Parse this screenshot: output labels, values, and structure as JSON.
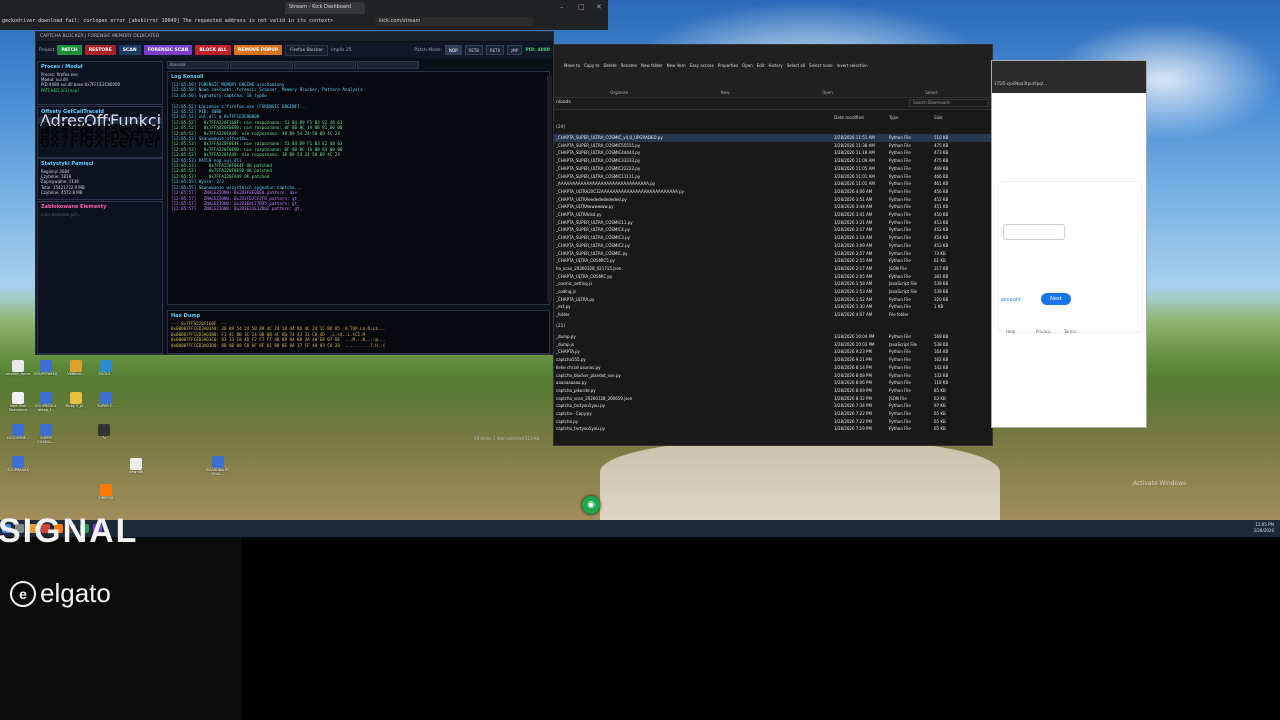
{
  "browser": {
    "tab_title": "Stream - Kick Dashboard",
    "error_text": "geckodriver download fail: curlopen error [abskirror 10049] The requested address is not valid in its context>",
    "url": "kick.com/stream"
  },
  "bottom": {
    "signal_text": "SIGNAL",
    "brand": "elgato"
  },
  "app": {
    "title": "CAPTCHA BLOCKER | FORENSIC MEMORY DEDICATED",
    "toolbar": {
      "project_label": "Project",
      "patch": "PATCH",
      "restore": "RESTORE",
      "scan": "SCAN",
      "forensic_scan": "FORENSIC SCAN",
      "block_all": "BLOCK ALL",
      "remove_popup": "REMOVE POPUP",
      "browser_select": "Firefox Blocker",
      "impl_label": "Implis 25",
      "patch_mode_label": "Patch Mode:",
      "modes": [
        "NOP",
        "RETB",
        "RET0",
        "JMP"
      ],
      "pid_label": "PID: 4080"
    },
    "process": {
      "heading": "Proces / Moduł",
      "lines": [
        "Proces: firefox.exe",
        "Moduł: xul.dll",
        "PID:4080 xul.dll base:0x7FFCE3C80000",
        "PATCHED 3/3 [nop]"
      ]
    },
    "offsets": {
      "heading": "Offsety GetCallTraceId",
      "col_addr": "Adres",
      "col_off": "Offset",
      "col_fn": "Funkcja",
      "rows": [
        {
          "addr": "0x7FFA220F160F",
          "off": "0xF164F",
          "fn": "serverCall->GetCa"
        },
        {
          "addr": "0x7FFA220F0E9D",
          "off": "0xF0E9D",
          "fn": "pServerCall->GetC"
        },
        {
          "addr": "0x7FFA220FA49",
          "off": "0xFA49",
          "fn": "serverCall->GetCa"
        }
      ]
    },
    "stats": {
      "heading": "Statystyki Pamięci",
      "lines": [
        "Regiony: 3084",
        "Czytelne: 1818",
        "Zapisywalne: 1136",
        "Total: 15421722.9 MB",
        "Czytelne: 4572.8 MB"
      ]
    },
    "blocked": {
      "heading": "Zablokowane Elementy",
      "placeholder": "Lista blokowanych..."
    },
    "log_tabs": [
      "Konsola",
      "",
      "",
      ""
    ],
    "log": {
      "heading": "Log Konsoli",
      "lines": [
        {
          "t": "[12:05:50] FORENSIC MEMORY ENGINE uruchomiony",
          "c": "#5fd1ff"
        },
        {
          "t": "[12:05:50] Nowe zakładki: forensic Scanner, Memory Blocker, Pattern Analysis",
          "c": "#5fd1ff"
        },
        {
          "t": "[12:05:50] Sygnatury captcha: 18 typów",
          "c": "#5fd1ff"
        },
        {
          "t": "",
          "c": "#5fd1ff"
        },
        {
          "t": "[12:05:52] Łączenie z firefox.exe [FORENSIC ENGINE]...",
          "c": "#5fd1ff"
        },
        {
          "t": "[12:05:52] PID: 4080",
          "c": "#5fd1ff"
        },
        {
          "t": "[12:05:52] xul.dll @ 0x7FFCE3C80000",
          "c": "#5fd1ff"
        },
        {
          "t": "[12:05:52]   0x7FFA220F160F: nie rozpoznano: 53 84 B9 F1 B3 E2 48 63",
          "c": "#6fe08a"
        },
        {
          "t": "[12:05:52]   0x7FFA220F0E9D: nie rozpoznano: 0F 88 8C 1A 0B 81 00 00",
          "c": "#6fe08a"
        },
        {
          "t": "[12:05:52]   0x7FFA220FA49: nie rozpoznano: 38 B9 54 24 50 B9 4C 24",
          "c": "#6fe08a"
        },
        {
          "t": "[12:05:53] Skanowanie offsetów...",
          "c": "#5fd1ff"
        },
        {
          "t": "[12:05:53]   0x7FFA220F0E4F: nie rozpoznano: 53 84 B9 F1 B3 E2 48 63",
          "c": "#6fe08a"
        },
        {
          "t": "[12:05:53]   0x7FFA220F0E9D: nie rozpoznano: 0F 88 8C 1A 0B 81 00 00",
          "c": "#6fe08a"
        },
        {
          "t": "[12:05:53]   0x7FFA220FA49: nie rozpoznano: 38 B9 54 24 50 B9 4C 24",
          "c": "#6fe08a"
        },
        {
          "t": "[12:05:53] PATCH nop xul.dll",
          "c": "#5fd1ff"
        },
        {
          "t": "[12:05:53]     0x7FFA220F0E4F OK patched",
          "c": "#6fe08a"
        },
        {
          "t": "[12:05:53]     0x7FFA220F0E9D OK patched",
          "c": "#6fe08a"
        },
        {
          "t": "[12:05:53]     0x7FFA220FA49 OK patched",
          "c": "#6fe08a"
        },
        {
          "t": "[12:05:55] Wynik: 3/3",
          "c": "#5fd1ff"
        },
        {
          "t": "[12:05:55] Skanowanie wszystkich sygnatur captcha...",
          "c": "#5fd1ff"
        },
        {
          "t": "[12:05:57]   ZNALEZIONO: 0x2D1F8E0DE0 pattern: div",
          "c": "#c77dff"
        },
        {
          "t": "[12:05:57]   ZNALEZIONO: 0x2D1FD2CF2F0 pattern: gt_",
          "c": "#c77dff"
        },
        {
          "t": "[12:05:57]   ZNALEZIONO: 0x2D1E0C77B95 pattern: gt_",
          "c": "#c77dff"
        },
        {
          "t": "[12:05:57]   ZNALEZIONO: 0x2D1E31E12D02 pattern: gt_",
          "c": "#c77dff"
        }
      ]
    },
    "hex": {
      "heading": "Hex Dump",
      "lines": [
        "--- 0x7FFA220F160F ---",
        "0x00007FFCED3A03A0: 38 89 54 24 50 89 4C 24 18 44 8D 4C 24 1C 8D 85  8.T$P.L$.D.L$...",
        "0x00007FFCED3A03B0: F1 4C 8B 3C 24 0B 0B 4C 8D 74 43 31 C0 4D  .L.<$..L.tC1.M",
        "0x00007FFCED3A03C0: 83 13 18 4D F2 F7 FF 4B 8B 04 B8 3A 40 E8 07 DE  ...M...K...:@...",
        "0x00007FFCED3A03D0: 8B 8B 08 C0 0F 8F 81 00 0E 8A 37 CF 48 83 C6 28  ..........7.H..("
      ]
    }
  },
  "explorer": {
    "ribbon": [
      "Move to",
      "Copy to",
      "Delete",
      "Rename",
      "New folder",
      "New item",
      "Easy access",
      "Properties",
      "Open",
      "Edit",
      "History",
      "Select all",
      "Select none",
      "Invert selection"
    ],
    "groups": [
      "Organize",
      "New",
      "Open",
      "Select"
    ],
    "search_placeholder": "Search Downloads",
    "path_tail": "nloads",
    "col_name": "Name",
    "col_date": "Date modified",
    "col_type": "Type",
    "col_size": "Size",
    "group_a": "(24)",
    "group_b": "(21)",
    "files_a": [
      {
        "n": "_CHAPTA_SUPER_ULTRA_COSMIC_v4.0_UPGRADED.py",
        "d": "3/28/2026 11:51 AM",
        "t": "Python File",
        "s": "510 KB"
      },
      {
        "n": "_CHAPTA_SUPER_ULTRA_COSMIC55555.py",
        "d": "3/28/2026 11:38 AM",
        "t": "Python File",
        "s": "475 KB"
      },
      {
        "n": "_CHAPTA_SUPER_ULTRA_COSMIC44444.py",
        "d": "3/28/2026 11:18 AM",
        "t": "Python File",
        "s": "473 KB"
      },
      {
        "n": "_CHAPTA_SUPER_ULTRA_COSMIC33333.py",
        "d": "3/28/2026 11:09 AM",
        "t": "Python File",
        "s": "475 KB"
      },
      {
        "n": "_CHAPTA_SUPER_ULTRA_COSMIC22222.py",
        "d": "3/28/2026 11:05 AM",
        "t": "Python File",
        "s": "469 KB"
      },
      {
        "n": "_CHAPTA_SUPER_ULTRA_COSMIC11111.py",
        "d": "3/28/2026 11:01 AM",
        "t": "Python File",
        "s": "466 KB"
      },
      {
        "n": "_AAAAAAAAAAAAAAAAAAAAAAAAAAAAAAAA.py",
        "d": "3/28/2026 11:01 AM",
        "t": "Python File",
        "s": "461 KB"
      },
      {
        "n": "_CHAPTA_ULTRA2XC32AAAAAAAAAAAAAAAAAAAAAAAAAAA.py",
        "d": "3/28/2026 4:06 AM",
        "t": "Python File",
        "s": "456 KB"
      },
      {
        "n": "_CHAPTA_ULTRAeedededededed.py",
        "d": "3/28/2026 3:51 AM",
        "t": "Python File",
        "s": "452 KB"
      },
      {
        "n": "_CHAPTA_ULTRAwwwwww.py",
        "d": "3/28/2026 3:44 AM",
        "t": "Python File",
        "s": "451 KB"
      },
      {
        "n": "_CHAPTA_ULTRAdsd.py",
        "d": "3/28/2026 3:41 AM",
        "t": "Python File",
        "s": "450 KB"
      },
      {
        "n": "_CHAPTA_SUPER_ULTRA_COSMIC11.py",
        "d": "3/28/2026 3:21 AM",
        "t": "Python File",
        "s": "453 KB"
      },
      {
        "n": "_CHAPTA_SUPER_ULTRA_COSMIC4.py",
        "d": "3/28/2026 3:17 AM",
        "t": "Python File",
        "s": "452 KB"
      },
      {
        "n": "_CHAPTA_SUPER_ULTRA_COSMIC3.py",
        "d": "3/28/2026 3:14 AM",
        "t": "Python File",
        "s": "454 KB"
      },
      {
        "n": "_CHAPTA_SUPER_ULTRA_COSMIC2.py",
        "d": "3/28/2026 3:09 AM",
        "t": "Python File",
        "s": "453 KB"
      },
      {
        "n": "_CHAPTA_SUPER_ULTRA_COSMIC.py",
        "d": "3/28/2026 2:57 AM",
        "t": "Python File",
        "s": "73 KB"
      },
      {
        "n": "_CHAPTA_ULTRA_COSMIC5.py",
        "d": "3/28/2026 2:55 AM",
        "t": "Python File",
        "s": "61 KB"
      },
      {
        "n": "ha_scan_20260328_021715.json",
        "d": "3/28/2026 2:17 AM",
        "t": "JSON File",
        "s": "317 KB"
      },
      {
        "n": "_CHAPTA_ULTRA_COSMIC.py",
        "d": "3/28/2026 2:05 AM",
        "t": "Python File",
        "s": "381 KB"
      },
      {
        "n": "_cosmic_setting.js",
        "d": "3/28/2026 1:58 AM",
        "t": "JavaScript File",
        "s": "538 KB"
      },
      {
        "n": "_coding.js",
        "d": "3/28/2026 1:53 AM",
        "t": "JavaScript File",
        "s": "538 KB"
      },
      {
        "n": "_CHAPTA_ULTRA.py",
        "d": "3/28/2026 1:52 AM",
        "t": "Python File",
        "s": "320 KB"
      },
      {
        "n": "_ext.py",
        "d": "3/28/2026 1:30 AM",
        "t": "Python File",
        "s": "1 KB"
      },
      {
        "n": "_folder",
        "d": "3/28/2026 4:07 AM",
        "t": "File folder",
        "s": ""
      }
    ],
    "files_b": [
      {
        "n": "_dump.py",
        "d": "3/28/2026 10:04 PM",
        "t": "Python File",
        "s": "568 KB"
      },
      {
        "n": "_dump.js",
        "d": "3/28/2026 10:03 PM",
        "t": "JavaScript File",
        "s": "538 KB"
      },
      {
        "n": "_CHAPTA.py",
        "d": "3/28/2026 9:23 PM",
        "t": "Python File",
        "s": "164 KB"
      },
      {
        "n": "captcha555.py",
        "d": "3/28/2026 9:21 PM",
        "t": "Python File",
        "s": "162 KB"
      },
      {
        "n": "Ilehe chciał usunac.py",
        "d": "3/28/2026 8:14 PM",
        "t": "Python File",
        "s": "142 KB"
      },
      {
        "n": "captcha_blocker_plandot_sve.py",
        "d": "3/28/2026 8:08 PM",
        "t": "Python File",
        "s": "132 KB"
      },
      {
        "n": "aaaaaaaaaa.py",
        "d": "3/28/2026 8:06 PM",
        "t": "Python File",
        "s": "118 KB"
      },
      {
        "n": "captcha_plkocde.py",
        "d": "3/28/2026 8:09 PM",
        "t": "Python File",
        "s": "85 KB"
      },
      {
        "n": "captcha_scan_20260328_200659.json",
        "d": "3/28/2026 8:32 PM",
        "t": "JSON File",
        "s": "63 KB"
      },
      {
        "n": "captcha_factyou5you.py",
        "d": "3/28/2026 7:34 PM",
        "t": "Python File",
        "s": "97 KB"
      },
      {
        "n": "captcha - Copy.py",
        "d": "3/28/2026 7:22 PM",
        "t": "Python File",
        "s": "65 KB"
      },
      {
        "n": "captcha.py",
        "d": "3/28/2026 7:22 PM",
        "t": "Python File",
        "s": "65 KB"
      },
      {
        "n": "captcha_factyou5you.py",
        "d": "3/28/2026 7:19 PM",
        "t": "Python File",
        "s": "65 KB"
      }
    ],
    "status": "59 items   1 item selected 513 KB"
  },
  "right_browser": {
    "url": "175/5-cjo/9ksa3tpuhfpq/...",
    "create_account": "account",
    "next": "Next",
    "help": "Help",
    "privacy": "Privacy",
    "terms": "Terms"
  },
  "desktop_icons": [
    {
      "label": "vicollec_mmm"
    },
    {
      "label": "SOUPSTAREX_ikyosmeniwer..."
    },
    {
      "label": "VKWinal..."
    },
    {
      "label": "TOOLS..."
    },
    {
      "label": "New Text Document"
    },
    {
      "label": "SOUPREDUL bleep_f..."
    },
    {
      "label": "Mnay S_pl..."
    },
    {
      "label": "SUPER F..."
    },
    {
      "label": "LOGOSYNE..."
    },
    {
      "label": "SUPER COSMIC..."
    },
    {
      "label": "7z"
    },
    {
      "label": "SOUPRAXXX"
    },
    {
      "label": "FIREFOX"
    },
    {
      "label": "new file"
    },
    {
      "label": "BOARDNA PC SOAI..."
    }
  ],
  "tray": {
    "time": "12:05 PM",
    "date": "3/28/2026"
  },
  "watermark": "Activate Windows"
}
